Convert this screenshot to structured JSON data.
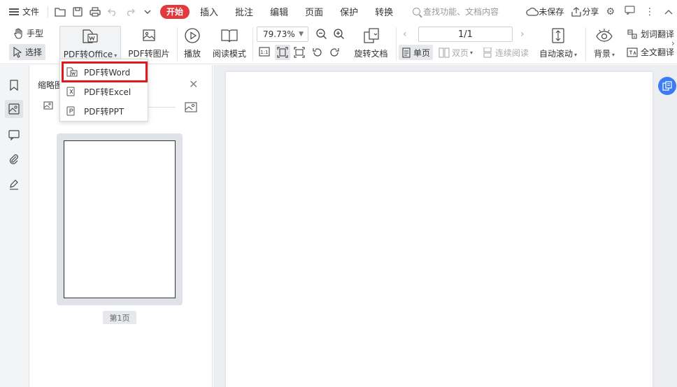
{
  "app": {
    "file_menu_label": "文件",
    "tabs": [
      "开始",
      "插入",
      "批注",
      "编辑",
      "页面",
      "保护",
      "转换"
    ],
    "active_tab": "开始",
    "search_placeholder": "查找功能、文档内容",
    "unsaved_label": "未保存",
    "share_label": "分享"
  },
  "ribbon": {
    "hand_label": "手型",
    "select_label": "选择",
    "pdf_to_office_label": "PDF转Office",
    "pdf_to_image_label": "PDF转图片",
    "play_label": "播放",
    "read_mode_label": "阅读模式",
    "zoom_value": "79.73%",
    "rotate_doc_label": "旋转文档",
    "page_indicator": "1/1",
    "single_page_label": "单页",
    "double_page_label": "双页",
    "continuous_label": "连续阅读",
    "auto_scroll_label": "自动滚动",
    "background_label": "背景",
    "word_translate_label": "划词翻译",
    "full_translate_label": "全文翻译"
  },
  "dropdown": {
    "items": [
      "PDF转Word",
      "PDF转Excel",
      "PDF转PPT"
    ],
    "highlighted_index": 0
  },
  "thumbnails": {
    "title": "缩略图",
    "page_label": "第1页"
  },
  "colors": {
    "accent_red": "#e2393d",
    "highlight_border": "#e0191e",
    "float_button_blue": "#3b7cf4"
  }
}
